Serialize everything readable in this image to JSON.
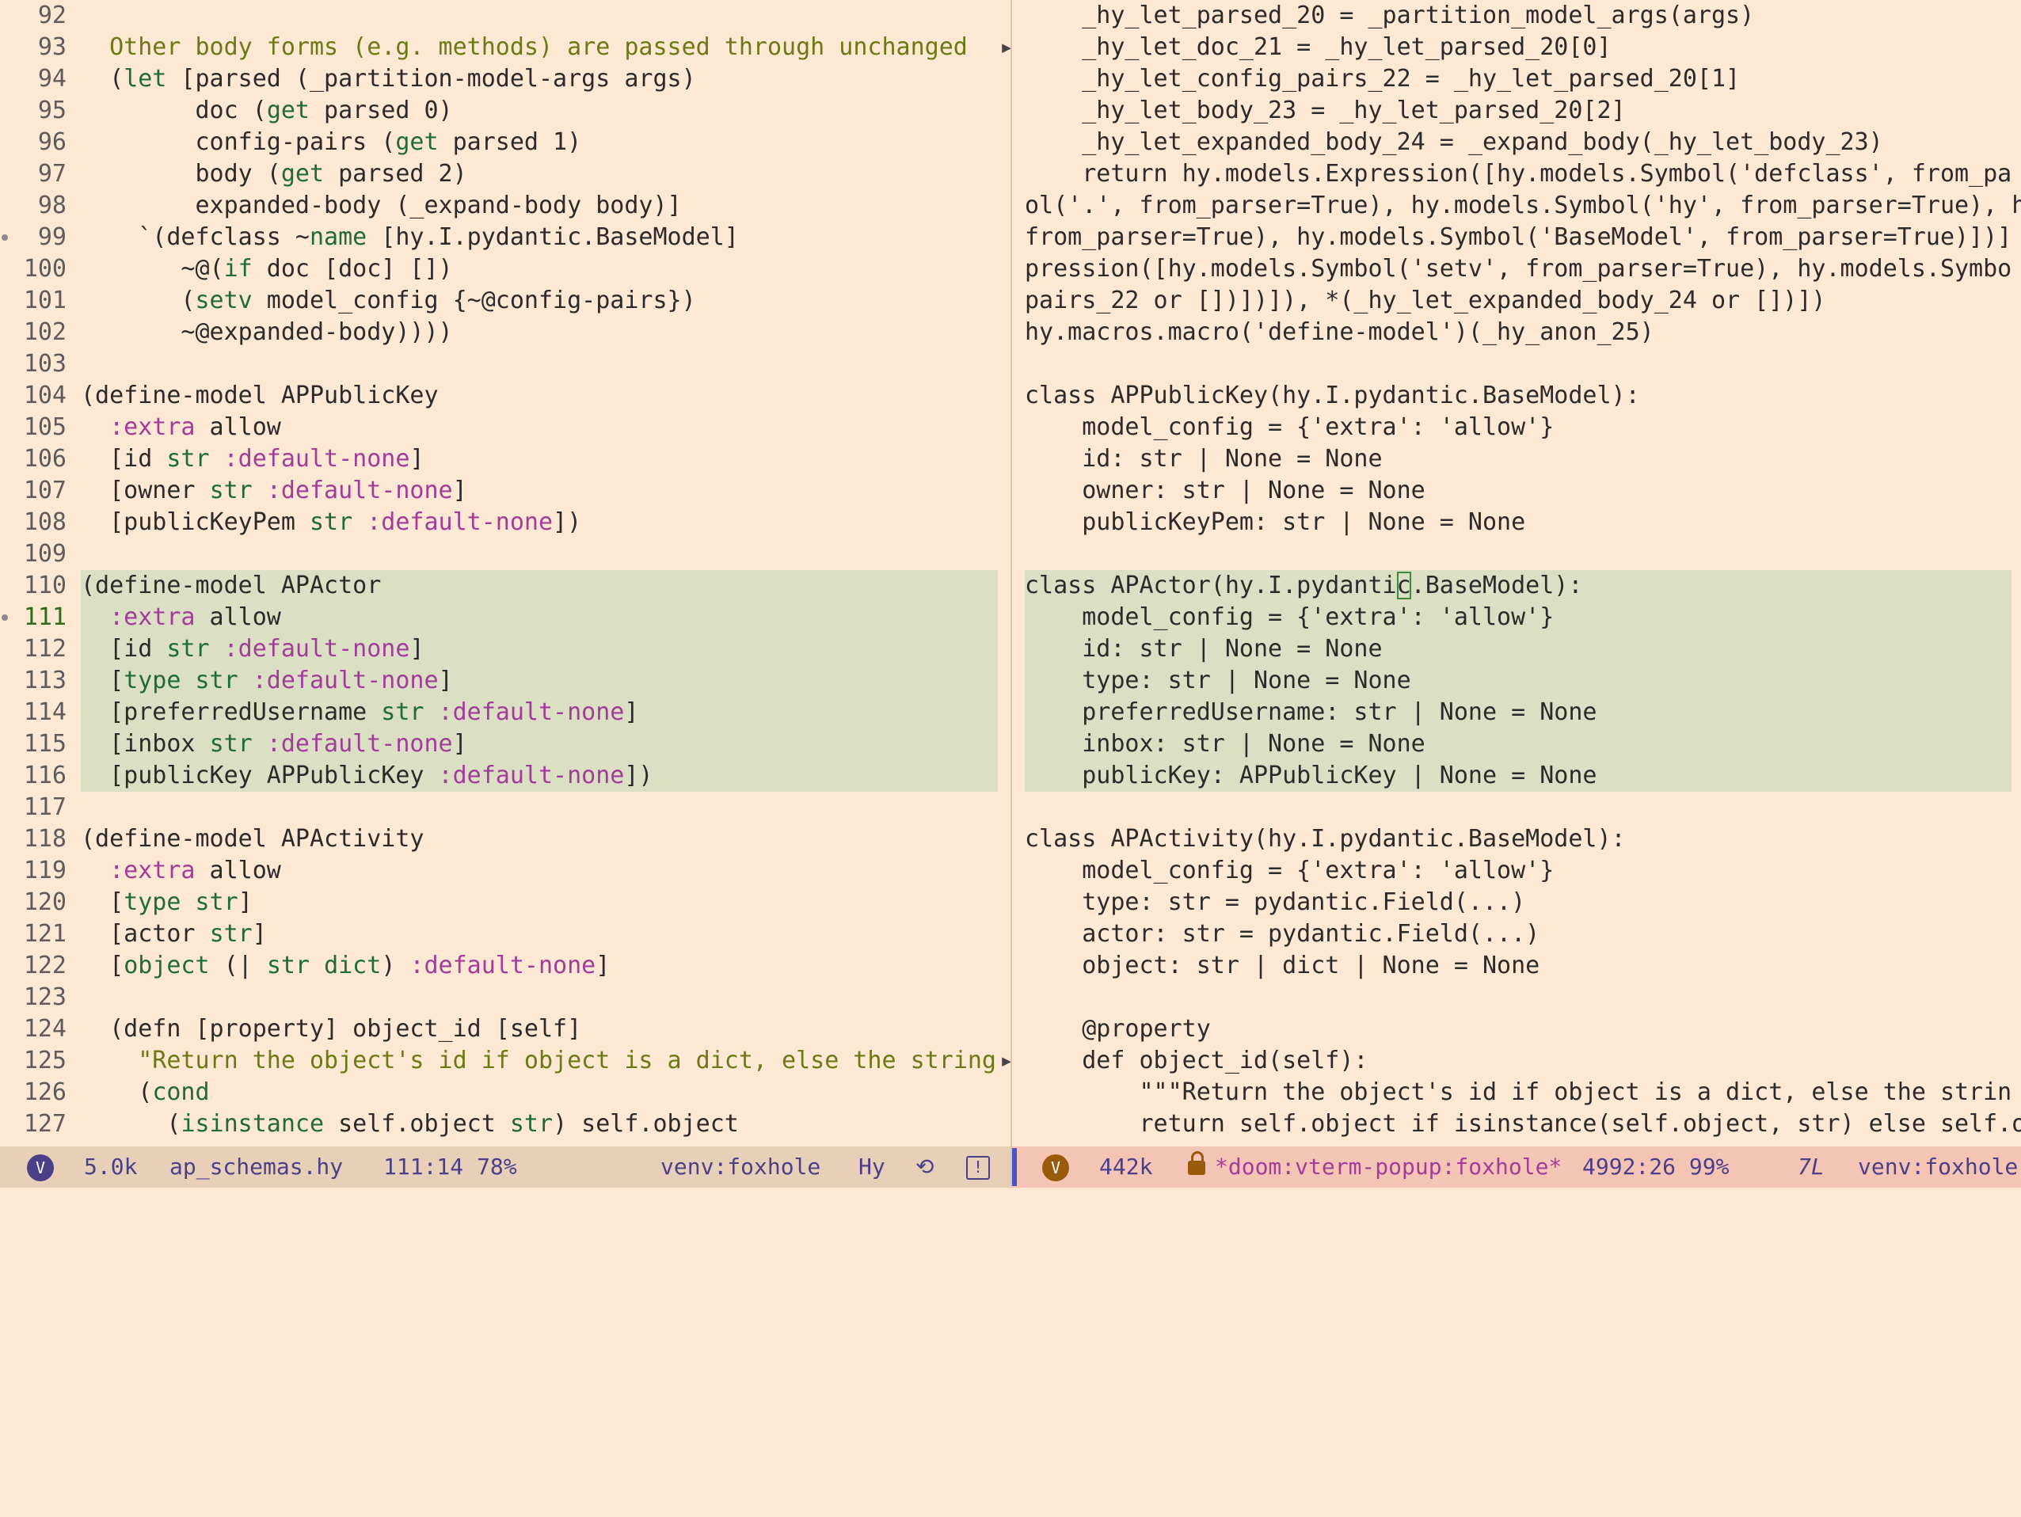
{
  "left_buffer": {
    "lines": [
      {
        "n": "92",
        "segs": [
          [
            "",
            " "
          ]
        ]
      },
      {
        "n": "93",
        "segs": [
          [
            "str",
            "  Other body forms (e.g. methods) are passed through unchanged"
          ]
        ],
        "trunc": true
      },
      {
        "n": "94",
        "segs": [
          [
            "",
            "  ("
          ],
          [
            "kw",
            "let"
          ],
          [
            "",
            " [parsed (_partition-model-args args)"
          ]
        ]
      },
      {
        "n": "95",
        "segs": [
          [
            "",
            "        doc ("
          ],
          [
            "kw",
            "get"
          ],
          [
            "",
            " parsed 0)"
          ]
        ]
      },
      {
        "n": "96",
        "segs": [
          [
            "",
            "        config-pairs ("
          ],
          [
            "kw",
            "get"
          ],
          [
            "",
            " parsed 1)"
          ]
        ]
      },
      {
        "n": "97",
        "segs": [
          [
            "",
            "        body ("
          ],
          [
            "kw",
            "get"
          ],
          [
            "",
            " parsed 2)"
          ]
        ]
      },
      {
        "n": "98",
        "segs": [
          [
            "",
            "        expanded-body (_expand-body body)]"
          ]
        ]
      },
      {
        "n": "99",
        "fringe": true,
        "segs": [
          [
            "",
            "    `(defclass ~"
          ],
          [
            "kw",
            "name"
          ],
          [
            "",
            " [hy.I.pydantic.BaseModel]"
          ]
        ]
      },
      {
        "n": "100",
        "segs": [
          [
            "",
            "       ~@("
          ],
          [
            "kw",
            "if"
          ],
          [
            "",
            " doc [doc] [])"
          ]
        ]
      },
      {
        "n": "101",
        "segs": [
          [
            "",
            "       ("
          ],
          [
            "kw",
            "setv"
          ],
          [
            "",
            " model_config {~@config-pairs})"
          ]
        ]
      },
      {
        "n": "102",
        "segs": [
          [
            "",
            "       ~@expanded-body))))"
          ]
        ]
      },
      {
        "n": "103",
        "segs": [
          [
            "",
            ""
          ]
        ]
      },
      {
        "n": "104",
        "segs": [
          [
            "",
            "(define-model APPublicKey"
          ]
        ]
      },
      {
        "n": "105",
        "segs": [
          [
            "",
            "  "
          ],
          [
            "kwd",
            ":extra"
          ],
          [
            "",
            " allow"
          ]
        ]
      },
      {
        "n": "106",
        "segs": [
          [
            "",
            "  [id "
          ],
          [
            "kw",
            "str"
          ],
          [
            "",
            " "
          ],
          [
            "kwd",
            ":default-none"
          ],
          [
            "",
            "]"
          ]
        ]
      },
      {
        "n": "107",
        "segs": [
          [
            "",
            "  [owner "
          ],
          [
            "kw",
            "str"
          ],
          [
            "",
            " "
          ],
          [
            "kwd",
            ":default-none"
          ],
          [
            "",
            "]"
          ]
        ]
      },
      {
        "n": "108",
        "segs": [
          [
            "",
            "  [publicKeyPem "
          ],
          [
            "kw",
            "str"
          ],
          [
            "",
            " "
          ],
          [
            "kwd",
            ":default-none"
          ],
          [
            "",
            "])"
          ]
        ]
      },
      {
        "n": "109",
        "segs": [
          [
            "",
            ""
          ]
        ]
      },
      {
        "n": "110",
        "hl": true,
        "segs": [
          [
            "",
            "(define-model APActor"
          ]
        ]
      },
      {
        "n": "111",
        "hl": true,
        "cur": true,
        "fringe": true,
        "segs": [
          [
            "",
            "  "
          ],
          [
            "kwd",
            ":extra"
          ],
          [
            "",
            " allow"
          ]
        ]
      },
      {
        "n": "112",
        "hl": true,
        "segs": [
          [
            "",
            "  [id "
          ],
          [
            "kw",
            "str"
          ],
          [
            "",
            " "
          ],
          [
            "kwd",
            ":default-none"
          ],
          [
            "",
            "]"
          ]
        ]
      },
      {
        "n": "113",
        "hl": true,
        "segs": [
          [
            "",
            "  ["
          ],
          [
            "kw",
            "type"
          ],
          [
            "",
            " "
          ],
          [
            "kw",
            "str"
          ],
          [
            "",
            " "
          ],
          [
            "kwd",
            ":default-none"
          ],
          [
            "",
            "]"
          ]
        ]
      },
      {
        "n": "114",
        "hl": true,
        "segs": [
          [
            "",
            "  [preferredUsername "
          ],
          [
            "kw",
            "str"
          ],
          [
            "",
            " "
          ],
          [
            "kwd",
            ":default-none"
          ],
          [
            "",
            "]"
          ]
        ]
      },
      {
        "n": "115",
        "hl": true,
        "segs": [
          [
            "",
            "  [inbox "
          ],
          [
            "kw",
            "str"
          ],
          [
            "",
            " "
          ],
          [
            "kwd",
            ":default-none"
          ],
          [
            "",
            "]"
          ]
        ]
      },
      {
        "n": "116",
        "hl": true,
        "segs": [
          [
            "",
            "  [publicKey APPublicKey "
          ],
          [
            "kwd",
            ":default-none"
          ],
          [
            "",
            "])"
          ]
        ]
      },
      {
        "n": "117",
        "segs": [
          [
            "",
            ""
          ]
        ]
      },
      {
        "n": "118",
        "segs": [
          [
            "",
            "(define-model APActivity"
          ]
        ]
      },
      {
        "n": "119",
        "segs": [
          [
            "",
            "  "
          ],
          [
            "kwd",
            ":extra"
          ],
          [
            "",
            " allow"
          ]
        ]
      },
      {
        "n": "120",
        "segs": [
          [
            "",
            "  ["
          ],
          [
            "kw",
            "type"
          ],
          [
            "",
            " "
          ],
          [
            "kw",
            "str"
          ],
          [
            "",
            "]"
          ]
        ]
      },
      {
        "n": "121",
        "segs": [
          [
            "",
            "  [actor "
          ],
          [
            "kw",
            "str"
          ],
          [
            "",
            "]"
          ]
        ]
      },
      {
        "n": "122",
        "segs": [
          [
            "",
            "  ["
          ],
          [
            "kw",
            "object"
          ],
          [
            "",
            " (| "
          ],
          [
            "kw",
            "str"
          ],
          [
            "",
            " "
          ],
          [
            "kw",
            "dict"
          ],
          [
            "",
            ") "
          ],
          [
            "kwd",
            ":default-none"
          ],
          [
            "",
            "]"
          ]
        ]
      },
      {
        "n": "123",
        "segs": [
          [
            "",
            ""
          ]
        ]
      },
      {
        "n": "124",
        "segs": [
          [
            "",
            "  (defn [property] object_id [self]"
          ]
        ]
      },
      {
        "n": "125",
        "segs": [
          [
            "str",
            "    \"Return the object's id if object is a dict, else the string"
          ]
        ],
        "trunc": true
      },
      {
        "n": "126",
        "segs": [
          [
            "",
            "    ("
          ],
          [
            "kw",
            "cond"
          ]
        ]
      },
      {
        "n": "127",
        "segs": [
          [
            "",
            "      ("
          ],
          [
            "kw",
            "isinstance"
          ],
          [
            "",
            " self.object "
          ],
          [
            "kw",
            "str"
          ],
          [
            "",
            ") self.object"
          ]
        ]
      }
    ]
  },
  "right_buffer": {
    "lines": [
      {
        "segs": [
          [
            "",
            "    _hy_let_parsed_20 = _partition_model_args(args)"
          ]
        ]
      },
      {
        "segs": [
          [
            "",
            "    _hy_let_doc_21 = _hy_let_parsed_20[0]"
          ]
        ]
      },
      {
        "segs": [
          [
            "",
            "    _hy_let_config_pairs_22 = _hy_let_parsed_20[1]"
          ]
        ]
      },
      {
        "segs": [
          [
            "",
            "    _hy_let_body_23 = _hy_let_parsed_20[2]"
          ]
        ]
      },
      {
        "segs": [
          [
            "",
            "    _hy_let_expanded_body_24 = _expand_body(_hy_let_body_23)"
          ]
        ]
      },
      {
        "segs": [
          [
            "",
            "    return hy.models.Expression([hy.models.Symbol('defclass', from_pa"
          ]
        ]
      },
      {
        "segs": [
          [
            "",
            "ol('.', from_parser=True), hy.models.Symbol('hy', from_parser=True), h"
          ]
        ]
      },
      {
        "segs": [
          [
            "",
            "from_parser=True), hy.models.Symbol('BaseModel', from_parser=True)])]"
          ]
        ]
      },
      {
        "segs": [
          [
            "",
            "pression([hy.models.Symbol('setv', from_parser=True), hy.models.Symbo"
          ]
        ]
      },
      {
        "segs": [
          [
            "",
            "pairs_22 or [])])]), *(_hy_let_expanded_body_24 or [])])"
          ]
        ]
      },
      {
        "segs": [
          [
            "",
            "hy.macros.macro('define-model')(_hy_anon_25)"
          ]
        ]
      },
      {
        "segs": [
          [
            "",
            ""
          ]
        ]
      },
      {
        "segs": [
          [
            "",
            "class APPublicKey(hy.I.pydantic.BaseModel):"
          ]
        ]
      },
      {
        "segs": [
          [
            "",
            "    model_config = {'extra': 'allow'}"
          ]
        ]
      },
      {
        "segs": [
          [
            "",
            "    id: str | None = None"
          ]
        ]
      },
      {
        "segs": [
          [
            "",
            "    owner: str | None = None"
          ]
        ]
      },
      {
        "segs": [
          [
            "",
            "    publicKeyPem: str | None = None"
          ]
        ]
      },
      {
        "segs": [
          [
            "",
            ""
          ]
        ]
      },
      {
        "hl": true,
        "segs": [
          [
            "",
            "class APActor(hy.I.pydanti"
          ],
          [
            "cursor",
            "c"
          ],
          [
            "",
            ".BaseModel):"
          ]
        ]
      },
      {
        "hl": true,
        "segs": [
          [
            "",
            "    model_config = {'extra': 'allow'}"
          ]
        ]
      },
      {
        "hl": true,
        "segs": [
          [
            "",
            "    id: str | None = None"
          ]
        ]
      },
      {
        "hl": true,
        "segs": [
          [
            "",
            "    type: str | None = None"
          ]
        ]
      },
      {
        "hl": true,
        "segs": [
          [
            "",
            "    preferredUsername: str | None = None"
          ]
        ]
      },
      {
        "hl": true,
        "segs": [
          [
            "",
            "    inbox: str | None = None"
          ]
        ]
      },
      {
        "hl": true,
        "segs": [
          [
            "",
            "    publicKey: APPublicKey | None = None"
          ]
        ]
      },
      {
        "segs": [
          [
            "",
            ""
          ]
        ]
      },
      {
        "segs": [
          [
            "",
            "class APActivity(hy.I.pydantic.BaseModel):"
          ]
        ]
      },
      {
        "segs": [
          [
            "",
            "    model_config = {'extra': 'allow'}"
          ]
        ]
      },
      {
        "segs": [
          [
            "",
            "    type: str = pydantic.Field(...)"
          ]
        ]
      },
      {
        "segs": [
          [
            "",
            "    actor: str = pydantic.Field(...)"
          ]
        ]
      },
      {
        "segs": [
          [
            "",
            "    object: str | dict | None = None"
          ]
        ]
      },
      {
        "segs": [
          [
            "",
            ""
          ]
        ]
      },
      {
        "segs": [
          [
            "",
            "    @property"
          ]
        ]
      },
      {
        "segs": [
          [
            "",
            "    def object_id(self):"
          ]
        ]
      },
      {
        "segs": [
          [
            "",
            "        \"\"\"Return the object's id if object is a dict, else the strin"
          ]
        ]
      },
      {
        "segs": [
          [
            "",
            "        return self.object if isinstance(self.object, str) else self.o"
          ]
        ]
      }
    ]
  },
  "modeline_left": {
    "mode_glyph": "V",
    "size": "5.0k",
    "buffer_name": "ap_schemas.hy",
    "position": "111:14 78%",
    "venv": "venv:foxhole",
    "major_mode": "Hy",
    "vc_glyph": "⟲",
    "warn_glyph": "!"
  },
  "modeline_right": {
    "mode_glyph": "V",
    "size": "442k",
    "buffer_name": "*doom:vterm-popup:foxhole*",
    "position": "4992:26 99%",
    "lines_indicator": "7L",
    "venv": "venv:foxhole"
  },
  "colors": {
    "background": "#fde8d3",
    "region_highlight": "#dbe0c4",
    "keyword": "#1f6b3a",
    "keyword_arg": "#a23c9b",
    "docstring": "#6b7a14",
    "modeline_left_bg": "#e7d0b7",
    "modeline_right_bg": "#f4c5b5"
  }
}
